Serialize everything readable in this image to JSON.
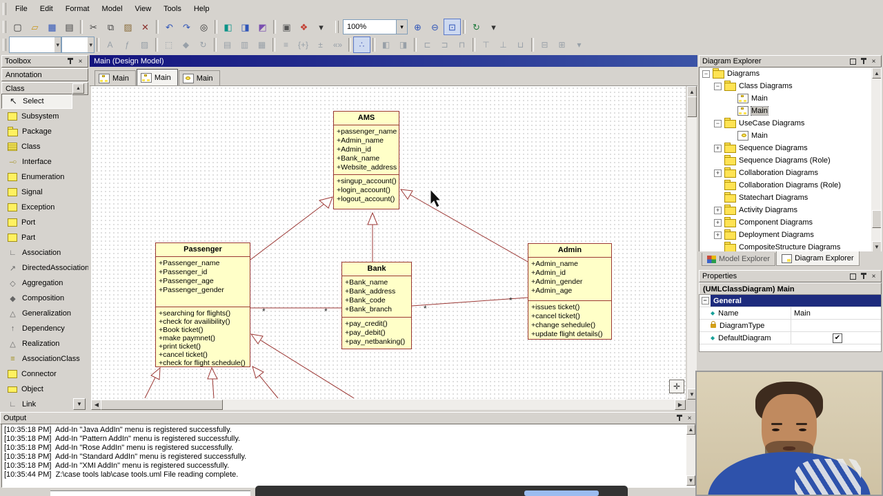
{
  "window": {
    "menu_items": [
      "File",
      "Edit",
      "Format",
      "Model",
      "View",
      "Tools",
      "Help"
    ]
  },
  "toolbar": {
    "zoom_value": "100%",
    "row1": [
      {
        "name": "new-file-button",
        "glyph": "▢",
        "css": "color:#333"
      },
      {
        "name": "open-button",
        "glyph": "▱",
        "css": "color:#c89418"
      },
      {
        "name": "save-button",
        "glyph": "▦",
        "css": "color:#2f55b8"
      },
      {
        "name": "print-button",
        "glyph": "▤",
        "css": "color:#444"
      },
      {
        "name": "separator",
        "i": "false"
      },
      {
        "name": "cut-button",
        "glyph": "✂",
        "css": "color:#444"
      },
      {
        "name": "copy-button",
        "glyph": "⧉",
        "css": "color:#444"
      },
      {
        "name": "paste-button",
        "glyph": "▨",
        "css": "color:#8a6d3b"
      },
      {
        "name": "delete-button",
        "glyph": "✕",
        "css": "color:#8a2f2b"
      },
      {
        "name": "separator",
        "i": "false"
      },
      {
        "name": "undo-button",
        "glyph": "↶",
        "css": "color:#2f55b8"
      },
      {
        "name": "redo-button",
        "glyph": "↷",
        "css": "color:#2f55b8"
      },
      {
        "name": "find-button",
        "glyph": "◎",
        "css": "color:#333"
      },
      {
        "name": "separator",
        "i": "false"
      },
      {
        "name": "overlay-model-button",
        "glyph": "◧",
        "css": "color:#0a9488"
      },
      {
        "name": "overlay-diagram-button",
        "glyph": "◨",
        "css": "color:#2f55b8"
      },
      {
        "name": "overlay-profile-button",
        "glyph": "◩",
        "css": "color:#7a4fb0"
      },
      {
        "name": "separator",
        "i": "false"
      },
      {
        "name": "xmi-button",
        "glyph": "▣",
        "css": "color:#555"
      },
      {
        "name": "palette-button",
        "glyph": "❖",
        "css": "color:#c23b2f"
      },
      {
        "name": "toolbar-overflow-button",
        "glyph": "▾",
        "css": "color:#333"
      }
    ],
    "row1b": [
      {
        "name": "zoom-in-button",
        "glyph": "⊕",
        "css": "color:#2f55b8"
      },
      {
        "name": "zoom-out-button",
        "glyph": "⊖",
        "css": "color:#2f55b8"
      },
      {
        "name": "zoom-region-button",
        "glyph": "⊡",
        "css": "color:#2f55b8",
        "state": "active"
      },
      {
        "name": "separator",
        "i": "false"
      },
      {
        "name": "refresh-button",
        "glyph": "↻",
        "css": "color:#1f7a3c"
      },
      {
        "name": "toolbar-overflow-button",
        "glyph": "▾",
        "css": "color:#333"
      }
    ],
    "row2": [
      {
        "name": "font-face-combo",
        "glyph": ""
      },
      {
        "name": "font-size-combo",
        "glyph": ""
      },
      {
        "name": "separator",
        "i": "false"
      },
      {
        "name": "font-color-button",
        "glyph": "A",
        "state": "disabled"
      },
      {
        "name": "font-style-button",
        "glyph": "ƒ",
        "state": "disabled"
      },
      {
        "name": "fill-color-button",
        "glyph": "▨",
        "state": "disabled"
      },
      {
        "name": "separator",
        "i": "false"
      },
      {
        "name": "select-style-button",
        "glyph": "⬚",
        "state": "disabled"
      },
      {
        "name": "shape-button",
        "glyph": "◆",
        "state": "disabled"
      },
      {
        "name": "rotate-button",
        "glyph": "↻",
        "state": "disabled"
      },
      {
        "name": "separator",
        "i": "false"
      },
      {
        "name": "suppress-attributes-button",
        "glyph": "▤",
        "state": "disabled"
      },
      {
        "name": "suppress-operations-button",
        "glyph": "▥",
        "state": "disabled"
      },
      {
        "name": "suppress-literals-button",
        "glyph": "▦",
        "state": "disabled"
      },
      {
        "name": "separator",
        "i": "false"
      },
      {
        "name": "stereotype-display-button",
        "glyph": "≡",
        "state": "disabled"
      },
      {
        "name": "show-visibility-button",
        "glyph": "{+}",
        "state": "disabled"
      },
      {
        "name": "show-property-button",
        "glyph": "±",
        "state": "disabled"
      },
      {
        "name": "show-guillemet-button",
        "glyph": "«»",
        "state": "disabled"
      },
      {
        "name": "separator",
        "i": "false"
      },
      {
        "name": "auto-layout-button",
        "glyph": "∴",
        "state": "active",
        "css": "color:#4a5fb8"
      },
      {
        "name": "separator",
        "i": "false"
      },
      {
        "name": "group-button",
        "glyph": "◧",
        "state": "disabled"
      },
      {
        "name": "ungroup-button",
        "glyph": "◨",
        "state": "disabled"
      },
      {
        "name": "separator",
        "i": "false"
      },
      {
        "name": "align-left-button",
        "glyph": "⊏",
        "state": "disabled"
      },
      {
        "name": "align-right-button",
        "glyph": "⊐",
        "state": "disabled"
      },
      {
        "name": "align-middle-button",
        "glyph": "⊓",
        "state": "disabled"
      },
      {
        "name": "separator",
        "i": "false"
      },
      {
        "name": "align-top-button",
        "glyph": "⊤",
        "state": "disabled"
      },
      {
        "name": "align-bottom-button",
        "glyph": "⊥",
        "state": "disabled"
      },
      {
        "name": "same-size-button",
        "glyph": "⊔",
        "state": "disabled"
      },
      {
        "name": "separator",
        "i": "false"
      },
      {
        "name": "space-horizontal-button",
        "glyph": "⊟",
        "state": "disabled"
      },
      {
        "name": "space-vertical-button",
        "glyph": "⊞",
        "state": "disabled"
      },
      {
        "name": "toolbar-overflow-button",
        "glyph": "▾"
      }
    ]
  },
  "toolbox": {
    "title": "Toolbox",
    "sections": [
      {
        "label": "Annotation"
      },
      {
        "label": "Class"
      }
    ],
    "items": [
      {
        "label": "Select",
        "icon": "select"
      },
      {
        "label": "Subsystem",
        "icon": "subsystem"
      },
      {
        "label": "Package",
        "icon": "package"
      },
      {
        "label": "Class",
        "icon": "class"
      },
      {
        "label": "Interface",
        "icon": "interface"
      },
      {
        "label": "Enumeration",
        "icon": "enumeration"
      },
      {
        "label": "Signal",
        "icon": "signal"
      },
      {
        "label": "Exception",
        "icon": "exception"
      },
      {
        "label": "Port",
        "icon": "port"
      },
      {
        "label": "Part",
        "icon": "part"
      },
      {
        "label": "Association",
        "icon": "association"
      },
      {
        "label": "DirectedAssociation",
        "icon": "directed-association"
      },
      {
        "label": "Aggregation",
        "icon": "aggregation"
      },
      {
        "label": "Composition",
        "icon": "composition"
      },
      {
        "label": "Generalization",
        "icon": "generalization"
      },
      {
        "label": "Dependency",
        "icon": "dependency"
      },
      {
        "label": "Realization",
        "icon": "realization"
      },
      {
        "label": "AssociationClass",
        "icon": "association-class"
      },
      {
        "label": "Connector",
        "icon": "connector"
      },
      {
        "label": "Object",
        "icon": "object"
      },
      {
        "label": "Link",
        "icon": "link"
      }
    ]
  },
  "document": {
    "titlebar": "Main (Design Model)",
    "tabs": [
      {
        "label": "Main",
        "icon": "class-diagram"
      },
      {
        "label": "Main",
        "icon": "class-diagram"
      },
      {
        "label": "Main",
        "icon": "usecase-diagram"
      }
    ]
  },
  "diagram": {
    "classes": [
      {
        "name": "AMS",
        "attributes": [
          "+passenger_name",
          "+Admin_name",
          "+Admin_id",
          "+Bank_name",
          "+Website_address"
        ],
        "operations": [
          "+singup_account()",
          "+login_account()",
          "+logout_account()"
        ]
      },
      {
        "name": "Passenger",
        "attributes": [
          "+Passenger_name",
          "+Passenger_id",
          "+Passenger_age",
          "+Passenger_gender"
        ],
        "operations": [
          "+searching for flights()",
          "+check for availibility()",
          "+Book ticket()",
          "+make paymnet()",
          "+print ticket()",
          "+cancel ticket()",
          "+check for flight schedule()"
        ]
      },
      {
        "name": "Bank",
        "attributes": [
          "+Bank_name",
          "+Bank_address",
          "+Bank_code",
          "+Bank_branch"
        ],
        "operations": [
          "+pay_credit()",
          "+pay_debit()",
          "+pay_netbanking()"
        ]
      },
      {
        "name": "Admin",
        "attributes": [
          "+Admin_name",
          "+Admin_id",
          "+Admin_gender",
          "+Admin_age"
        ],
        "operations": [
          "+issues ticket()",
          "+cancel ticket()",
          "+change sehedule()",
          "+update flight details()"
        ]
      }
    ],
    "multiplicities": [
      "*",
      "*",
      "*",
      "*"
    ]
  },
  "diagram_explorer": {
    "title": "Diagram Explorer",
    "tree": [
      {
        "label": "Diagrams",
        "level": 0,
        "toggle": "minus",
        "icon": "folder"
      },
      {
        "label": "Class Diagrams",
        "level": 1,
        "toggle": "minus",
        "icon": "folder"
      },
      {
        "label": "Main",
        "level": 2,
        "toggle": "none",
        "icon": "class-diagram"
      },
      {
        "label": "Main",
        "level": 2,
        "toggle": "none",
        "icon": "class-diagram",
        "selected": true
      },
      {
        "label": "UseCase Diagrams",
        "level": 1,
        "toggle": "minus",
        "icon": "folder"
      },
      {
        "label": "Main",
        "level": 2,
        "toggle": "none",
        "icon": "usecase-diagram"
      },
      {
        "label": "Sequence Diagrams",
        "level": 1,
        "toggle": "plus",
        "icon": "folder"
      },
      {
        "label": "Sequence Diagrams (Role)",
        "level": 1,
        "toggle": "none",
        "icon": "folder"
      },
      {
        "label": "Collaboration Diagrams",
        "level": 1,
        "toggle": "plus",
        "icon": "folder"
      },
      {
        "label": "Collaboration Diagrams (Role)",
        "level": 1,
        "toggle": "none",
        "icon": "folder"
      },
      {
        "label": "Statechart Diagrams",
        "level": 1,
        "toggle": "none",
        "icon": "folder"
      },
      {
        "label": "Activity Diagrams",
        "level": 1,
        "toggle": "plus",
        "icon": "folder"
      },
      {
        "label": "Component Diagrams",
        "level": 1,
        "toggle": "plus",
        "icon": "folder"
      },
      {
        "label": "Deployment Diagrams",
        "level": 1,
        "toggle": "plus",
        "icon": "folder"
      },
      {
        "label": "CompositeStructure Diagrams",
        "level": 1,
        "toggle": "none",
        "icon": "folder"
      }
    ],
    "tabs": [
      {
        "label": "Model Explorer"
      },
      {
        "label": "Diagram Explorer"
      }
    ]
  },
  "properties": {
    "title": "Properties",
    "selection": "(UMLClassDiagram) Main",
    "section": "General",
    "checkmark": "✔",
    "rows": [
      {
        "label": "Name",
        "value": "Main"
      },
      {
        "label": "DiagramType",
        "value": ""
      },
      {
        "label": "DefaultDiagram",
        "value": ""
      }
    ]
  },
  "output": {
    "title": "Output",
    "lines": [
      "[10:35:18 PM]  Add-In \"Java AddIn\" menu is registered successfully.",
      "[10:35:18 PM]  Add-In \"Pattern AddIn\" menu is registered successfully.",
      "[10:35:18 PM]  Add-In \"Rose AddIn\" menu is registered successfully.",
      "[10:35:18 PM]  Add-In \"Standard AddIn\" menu is registered successfully.",
      "[10:35:18 PM]  Add-In \"XMI AddIn\" menu is registered successfully.",
      "[10:35:44 PM]  Z:\\case tools lab\\case tools.uml File reading complete."
    ]
  }
}
